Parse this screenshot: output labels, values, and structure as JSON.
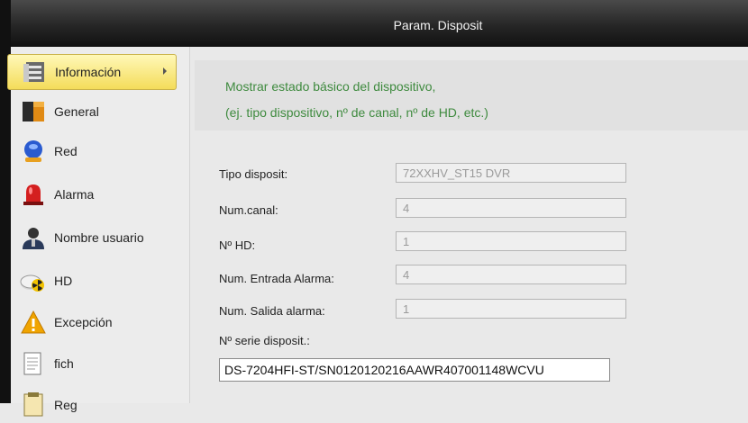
{
  "window": {
    "title": "Param. Disposit"
  },
  "sidebar": {
    "items": [
      {
        "label": "Información",
        "icon": "server-icon",
        "active": true
      },
      {
        "label": "General",
        "icon": "general-icon"
      },
      {
        "label": "Red",
        "icon": "network-icon"
      },
      {
        "label": "Alarma",
        "icon": "alarm-icon"
      },
      {
        "label": "Nombre usuario",
        "icon": "user-icon"
      },
      {
        "label": "HD",
        "icon": "hdd-icon"
      },
      {
        "label": "Excepción",
        "icon": "warning-icon"
      },
      {
        "label": "fich",
        "icon": "file-icon"
      },
      {
        "label": "Reg",
        "icon": "log-icon"
      }
    ]
  },
  "info": {
    "description_line1": "Mostrar estado básico del dispositivo,",
    "description_line2": "(ej. tipo dispositivo, nº de canal, nº de HD, etc.)",
    "fields": [
      {
        "label": "Tipo disposit:",
        "value": "72XXHV_ST15 DVR"
      },
      {
        "label": "Num.canal:",
        "value": "4"
      },
      {
        "label": "Nº HD:",
        "value": "1"
      },
      {
        "label": "Num. Entrada Alarma:",
        "value": "4"
      },
      {
        "label": "Num. Salida alarma:",
        "value": "1"
      }
    ],
    "serial_label": "Nº serie disposit.:",
    "serial_value": "DS-7204HFI-ST/SN0120120216AAWR407001148WCVU"
  },
  "colors": {
    "description_text": "#3e8a3e",
    "active_item": "#f4dc5a",
    "titlebar": "#262626"
  }
}
